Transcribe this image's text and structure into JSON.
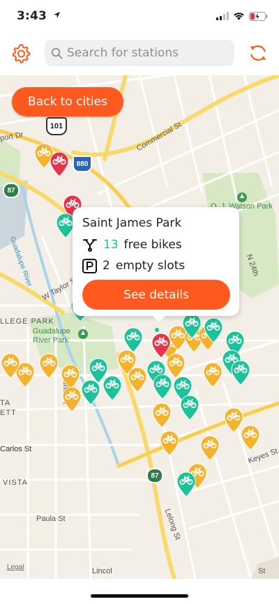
{
  "status_bar": {
    "time": "3:43"
  },
  "search": {
    "placeholder": "Search for stations"
  },
  "map": {
    "back_button": "Back to cities",
    "labels": {
      "commercial_st": "Commercial St",
      "guadalupe_river": "Guadalupe River",
      "w_taylor_st": "W Taylor St",
      "college_park": "LLEGE PARK",
      "guadalupe_river_park": "Guadalupe\nRiver Park",
      "oj_watson_park": "O. J. Watson Park",
      "n_24th": "N 24th",
      "sunol_st": "Sunol St",
      "carlos_st": "Carlos St",
      "vista": "VISTA",
      "paula_st": "Paula St",
      "keyes_st": "Keyes St",
      "lelong_st": "Lelong St",
      "port_dr": "port Dr",
      "hwy_101": "101",
      "hwy_880": "880",
      "hwy_87a": "87",
      "hwy_87b": "87",
      "ta": "TA",
      "ett": "ETT",
      "legal": "Legal",
      "lincoln": "Lincol",
      "st_a": "St"
    }
  },
  "popup": {
    "station_name": "Saint James Park",
    "free_bikes_count": "13",
    "free_bikes_label": "free bikes",
    "empty_slots_count": "2",
    "empty_slots_label": "empty slots",
    "details_button": "See details"
  },
  "colors": {
    "accent": "#fe5a20",
    "pin_green": "#1cc299",
    "pin_yellow": "#f4b22d",
    "pin_red": "#e5334b",
    "free_bikes_number": "#1cc299"
  }
}
